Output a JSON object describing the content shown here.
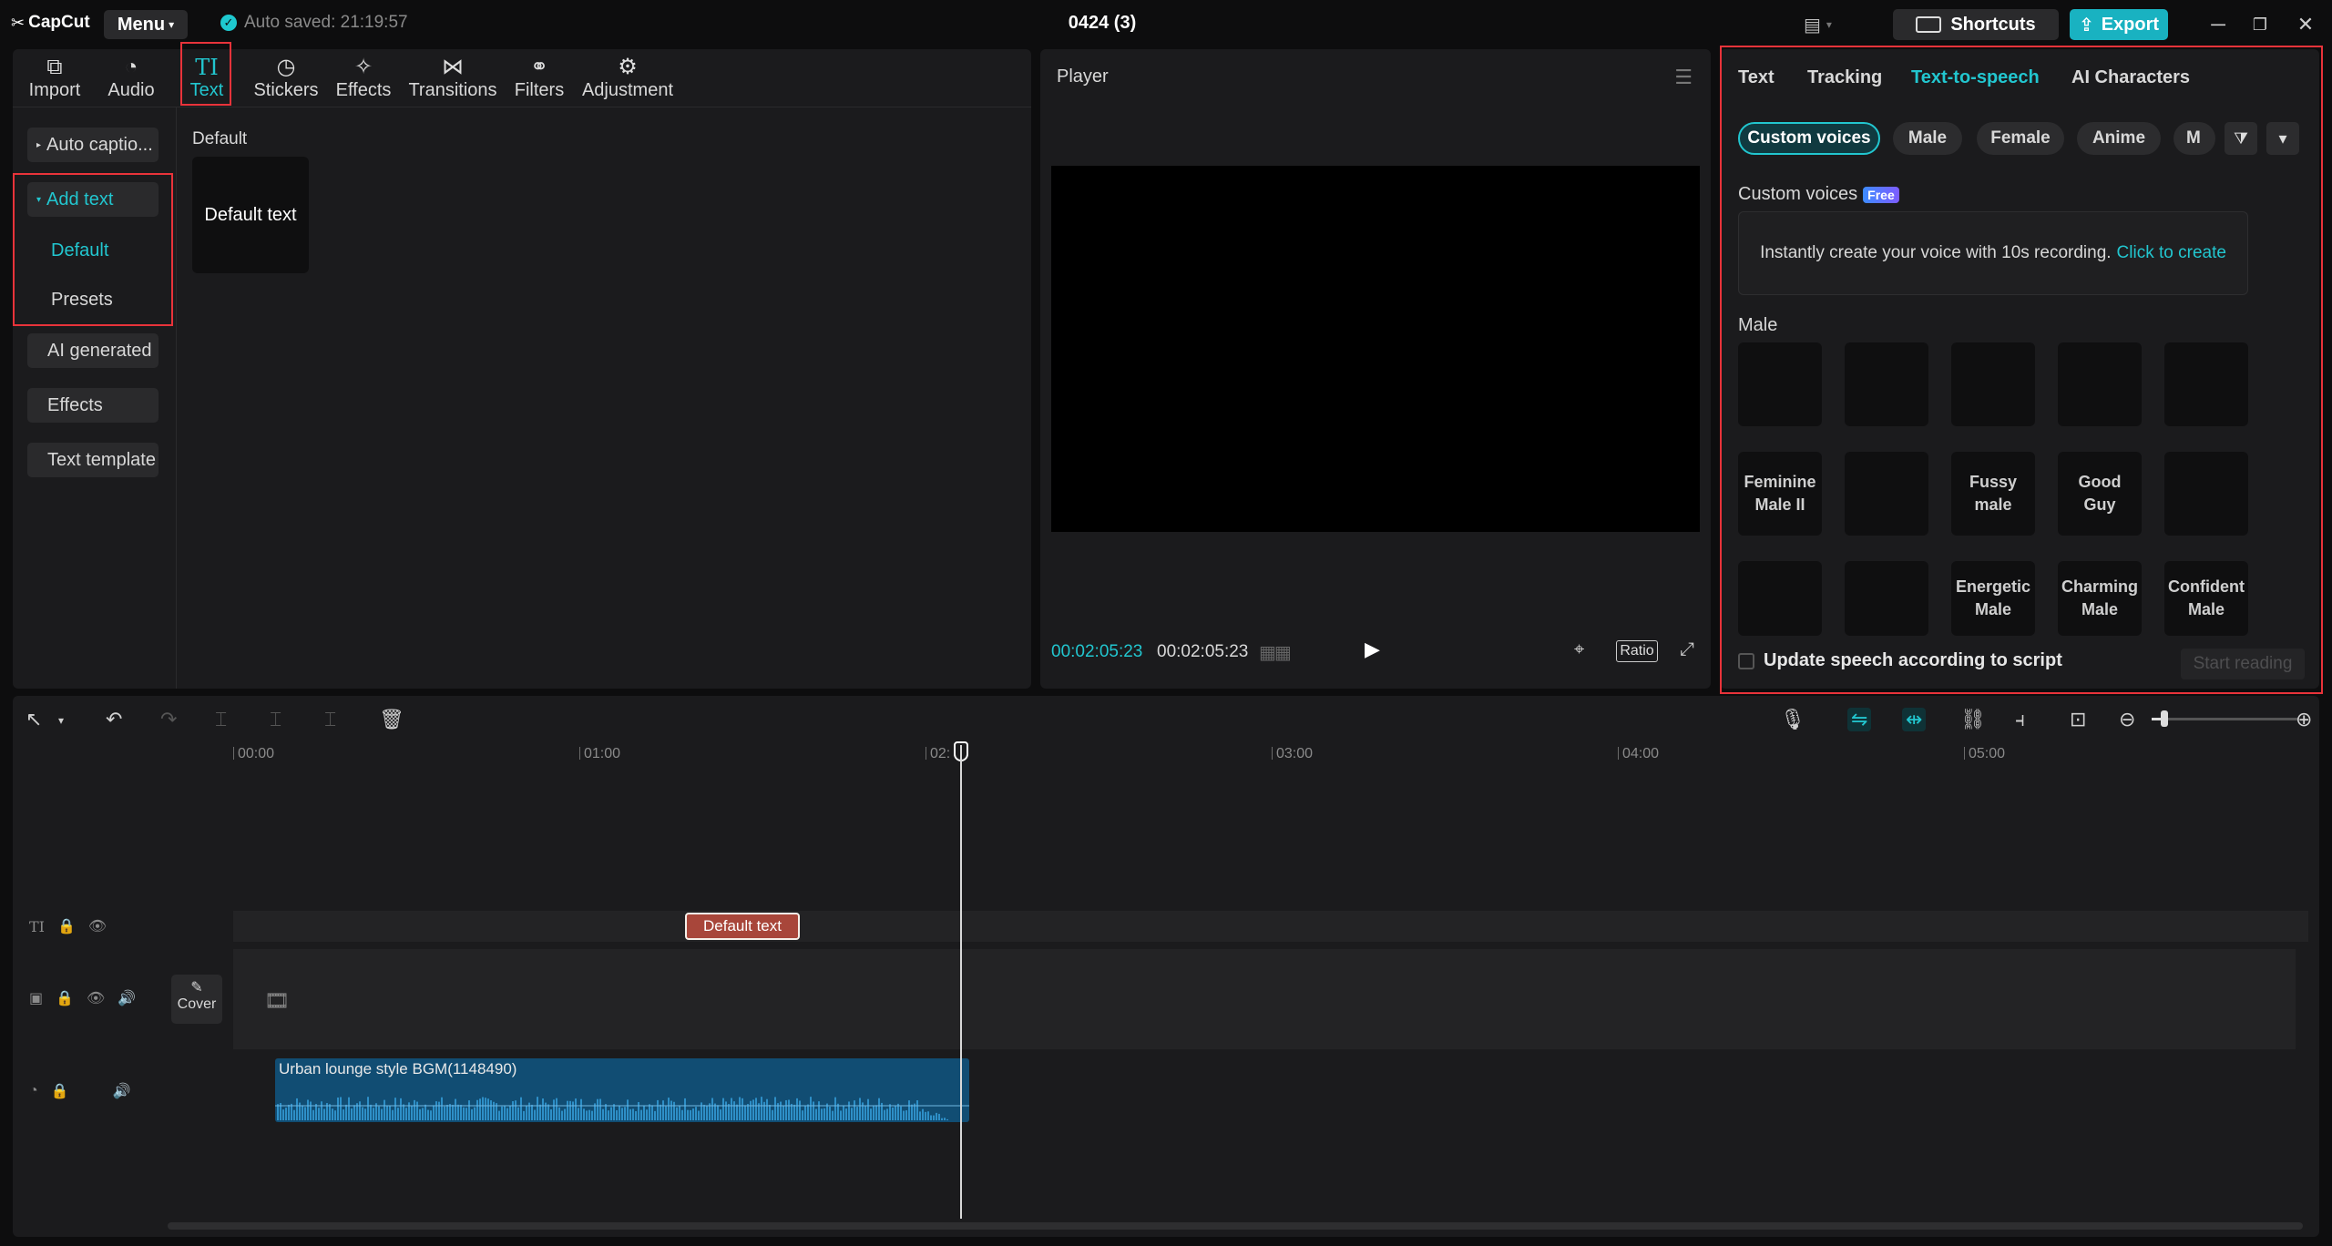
{
  "titlebar": {
    "app_name": "CapCut",
    "menu_label": "Menu",
    "autosave_text": "Auto saved: 21:19:57",
    "project_title": "0424 (3)",
    "shortcuts_label": "Shortcuts",
    "export_label": "Export"
  },
  "tool_tabs": [
    {
      "label": "Import",
      "icon": "import-icon"
    },
    {
      "label": "Audio",
      "icon": "audio-icon"
    },
    {
      "label": "Text",
      "icon": "text-icon",
      "active": true
    },
    {
      "label": "Stickers",
      "icon": "stickers-icon"
    },
    {
      "label": "Effects",
      "icon": "effects-icon"
    },
    {
      "label": "Transitions",
      "icon": "transitions-icon"
    },
    {
      "label": "Filters",
      "icon": "filters-icon"
    },
    {
      "label": "Adjustment",
      "icon": "adjustment-icon"
    }
  ],
  "sidebar": {
    "auto_captions": "Auto captio...",
    "add_text": "Add text",
    "default": "Default",
    "presets": "Presets",
    "ai_generated": "AI generated",
    "effects": "Effects",
    "text_template": "Text template"
  },
  "content": {
    "section_title": "Default",
    "card_label": "Default text"
  },
  "player": {
    "title": "Player",
    "time_current": "00:02:05:23",
    "time_total": "00:02:05:23",
    "ratio_label": "Ratio"
  },
  "right_panel": {
    "tabs": [
      "Text",
      "Tracking",
      "Text-to-speech",
      "AI Characters"
    ],
    "active_tab": "Text-to-speech",
    "chips": [
      "Custom voices",
      "Male",
      "Female",
      "Anime",
      "M"
    ],
    "custom_voices_title": "Custom voices",
    "free_badge": "Free",
    "create_text": "Instantly create your voice with 10s recording.",
    "create_link": "Click to create",
    "male_title": "Male",
    "voices_row1": [
      "",
      "",
      "",
      "",
      ""
    ],
    "voices_row2": [
      "Feminine Male II",
      "",
      "Fussy male",
      "Good Guy",
      ""
    ],
    "voices_row3": [
      "",
      "",
      "Energetic Male",
      "Charming Male",
      "Confident Male"
    ],
    "update_label": "Update speech according to script",
    "start_reading_label": "Start reading"
  },
  "timeline": {
    "ruler": [
      "00:00",
      "01:00",
      "02:",
      "03:00",
      "04:00",
      "05:00"
    ],
    "text_clip_label": "Default text",
    "cover_label": "Cover",
    "audio_clip_label": "Urban lounge style BGM(1148490)"
  }
}
